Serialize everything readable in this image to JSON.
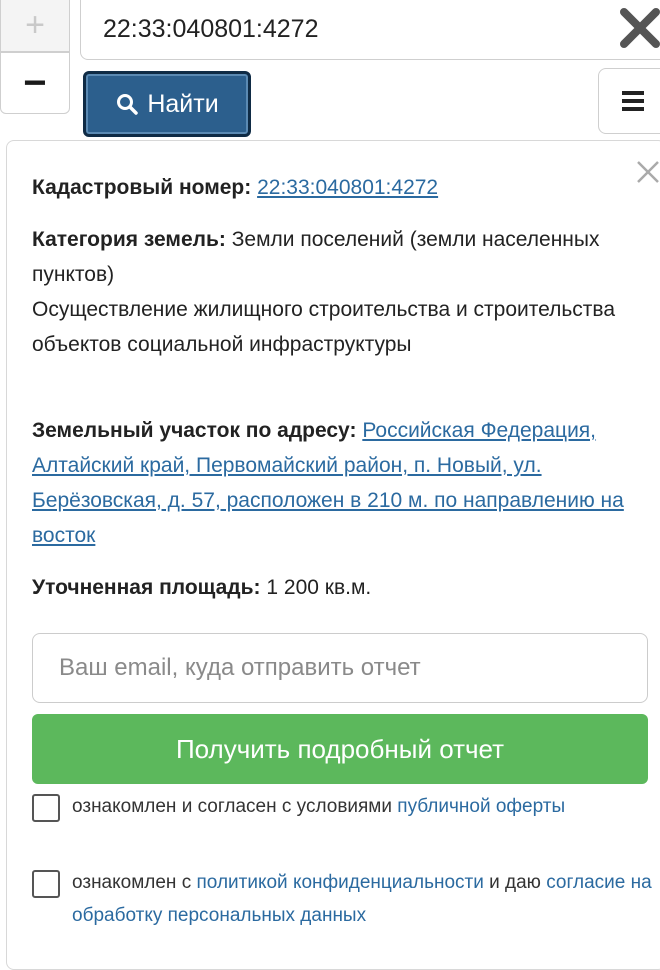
{
  "map_controls": {
    "zoom_in": "+",
    "zoom_out": "−"
  },
  "search": {
    "value": "22:33:040801:4272",
    "button_label": "Найти"
  },
  "parcel": {
    "cadastral_label": "Кадастровый номер:",
    "cadastral_number": "22:33:040801:4272",
    "category_label": "Категория земель:",
    "category_value": "Земли поселений (земли населенных пунктов)",
    "usage": "Осуществление жилищного строительства и строительства объектов социальной инфраструктуры",
    "address_label": "Земельный участок по адресу:",
    "address_value": "Российская Федерация, Алтайский край, Первомайский район, п. Новый, ул. Берёзовская, д. 57, расположен в 210 м. по направлению на восток",
    "area_label": "Уточненная площадь:",
    "area_value": "1 200 кв.м."
  },
  "report_form": {
    "email_placeholder": "Ваш email, куда отправить отчет",
    "submit_label": "Получить подробный отчет"
  },
  "consents": {
    "offer_text": "ознакомлен и согласен с условиями",
    "offer_link": "публичной оферты",
    "privacy_text_before": "ознакомлен с",
    "privacy_link": "политикой конфиденциальности",
    "privacy_text_middle": "и даю",
    "processing_link": "согласие на обработку персональных данных"
  },
  "colors": {
    "search_button": "#2c5f8d",
    "report_button": "#5cb85c",
    "link": "#2b6aa0"
  },
  "icons": [
    "close-icon",
    "search-icon",
    "menu-icon"
  ]
}
